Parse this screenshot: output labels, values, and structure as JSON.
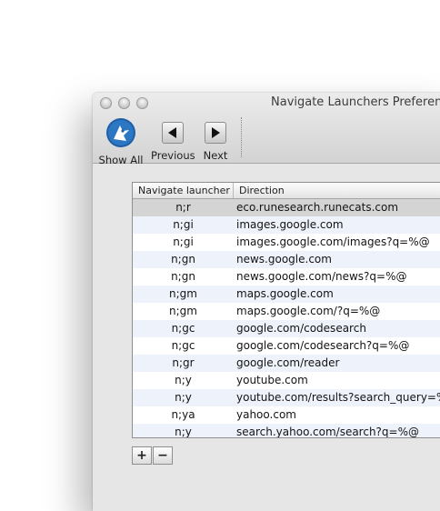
{
  "window": {
    "title": "Navigate Launchers Preferenc"
  },
  "toolbar": {
    "show_all": "Show All",
    "previous": "Previous",
    "next": "Next"
  },
  "table": {
    "columns": [
      "Navigate launcher",
      "Direction"
    ],
    "rows": [
      {
        "launcher": "n;r",
        "direction": "eco.runesearch.runecats.com"
      },
      {
        "launcher": "n;gi",
        "direction": "images.google.com"
      },
      {
        "launcher": "n;gi",
        "direction": "images.google.com/images?q=%@"
      },
      {
        "launcher": "n;gn",
        "direction": "news.google.com"
      },
      {
        "launcher": "n;gn",
        "direction": "news.google.com/news?q=%@"
      },
      {
        "launcher": "n;gm",
        "direction": "maps.google.com"
      },
      {
        "launcher": "n;gm",
        "direction": "maps.google.com/?q=%@"
      },
      {
        "launcher": "n;gc",
        "direction": "google.com/codesearch"
      },
      {
        "launcher": "n;gc",
        "direction": "google.com/codesearch?q=%@"
      },
      {
        "launcher": "n;gr",
        "direction": "google.com/reader"
      },
      {
        "launcher": "n;y",
        "direction": "youtube.com"
      },
      {
        "launcher": "n;y",
        "direction": "youtube.com/results?search_query=%@"
      },
      {
        "launcher": "n;ya",
        "direction": "yahoo.com"
      },
      {
        "launcher": "n;y",
        "direction": "search.yahoo.com/search?q=%@"
      }
    ]
  },
  "buttons": {
    "add": "+",
    "remove": "−"
  },
  "icons": [
    "show-all-icon",
    "previous-arrow-icon",
    "next-arrow-icon"
  ]
}
